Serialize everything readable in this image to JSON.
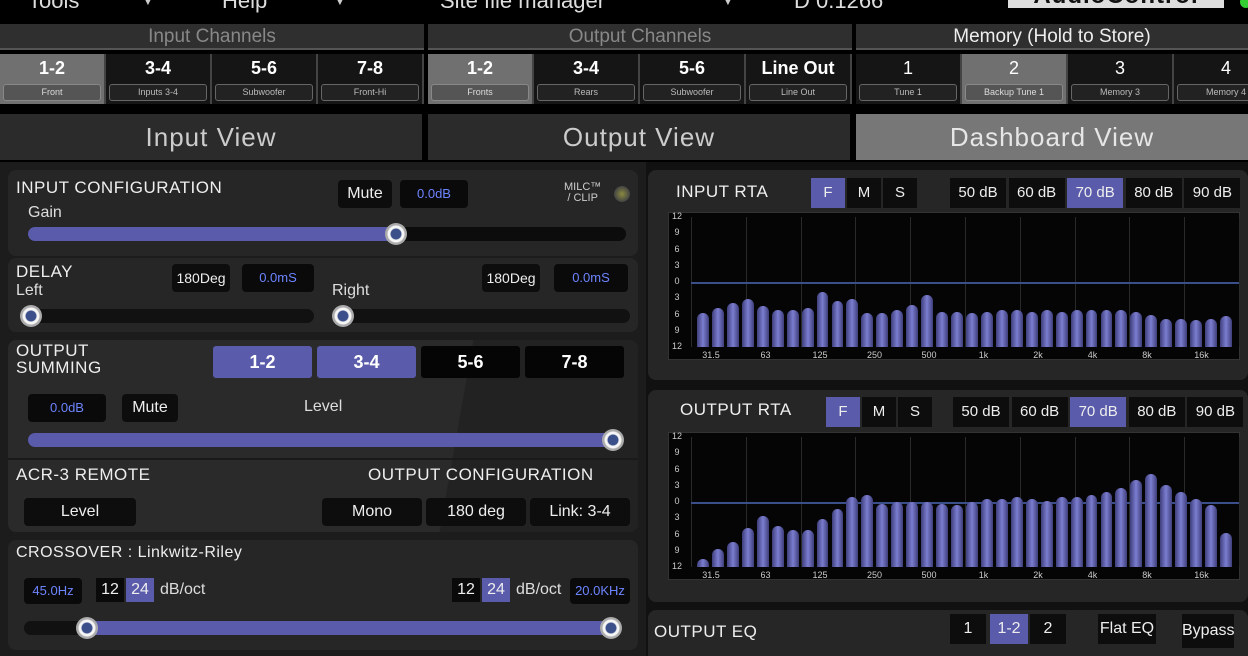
{
  "menu": {
    "tools": "Tools",
    "help": "Help",
    "site_file_manager": "Site file manager",
    "version": "D 0.1266",
    "logo": "AudioControl"
  },
  "input_channels": {
    "title": "Input Channels",
    "items": [
      {
        "num": "1-2",
        "label": "Front"
      },
      {
        "num": "3-4",
        "label": "Inputs 3-4"
      },
      {
        "num": "5-6",
        "label": "Subwoofer"
      },
      {
        "num": "7-8",
        "label": "Front-Hi"
      }
    ],
    "selected": 0
  },
  "output_channels": {
    "title": "Output Channels",
    "items": [
      {
        "num": "1-2",
        "label": "Fronts"
      },
      {
        "num": "3-4",
        "label": "Rears"
      },
      {
        "num": "5-6",
        "label": "Subwoofer"
      },
      {
        "num": "Line Out",
        "label": "Line Out"
      }
    ],
    "selected": 0
  },
  "memory": {
    "title": "Memory (Hold to Store)",
    "items": [
      {
        "num": "1",
        "label": "Tune 1"
      },
      {
        "num": "2",
        "label": "Backup Tune 1"
      },
      {
        "num": "3",
        "label": "Memory 3"
      },
      {
        "num": "4",
        "label": "Memory 4"
      }
    ],
    "selected": 1
  },
  "views": {
    "input": "Input View",
    "output": "Output View",
    "dashboard": "Dashboard View",
    "selected": "dashboard"
  },
  "input_config": {
    "title": "INPUT CONFIGURATION",
    "mute": "Mute",
    "gain_db": "0.0dB",
    "milc_line1": "MILC™",
    "milc_line2": "/ CLIP",
    "gain_label": "Gain",
    "gain_level": 0.62
  },
  "delay": {
    "title": "DELAY",
    "left_label": "Left",
    "right_label": "Right",
    "left_phase": "180Deg",
    "left_time": "0.0mS",
    "right_phase": "180Deg",
    "right_time": "0.0mS",
    "left_level": 0.0,
    "right_level": 0.0
  },
  "output_summing": {
    "title_line1": "OUTPUT",
    "title_line2": "SUMMING",
    "buttons": [
      {
        "label": "1-2",
        "on": true
      },
      {
        "label": "3-4",
        "on": true
      },
      {
        "label": "5-6",
        "on": false
      },
      {
        "label": "7-8",
        "on": false
      }
    ],
    "level_db": "0.0dB",
    "mute": "Mute",
    "level_label": "Level",
    "level": 1.0
  },
  "acr3": {
    "title": "ACR-3 REMOTE",
    "level_btn": "Level"
  },
  "output_config": {
    "title": "OUTPUT CONFIGURATION",
    "mono": "Mono",
    "phase": "180 deg",
    "link": "Link: 3-4"
  },
  "crossover": {
    "title": "CROSSOVER : Linkwitz-Riley",
    "hp_freq": "45.0Hz",
    "lp_freq": "20.0KHz",
    "slope_12": "12",
    "slope_24": "24",
    "unit": "dB/oct",
    "hp_level": 0.09,
    "lp_level": 1.0
  },
  "input_rta": {
    "title": "INPUT RTA",
    "modes": [
      "F",
      "M",
      "S"
    ],
    "mode_sel": 0,
    "ranges": [
      "50 dB",
      "60 dB",
      "70 dB",
      "80 dB",
      "90 dB"
    ],
    "range_sel": 2
  },
  "output_rta": {
    "title": "OUTPUT RTA",
    "modes": [
      "F",
      "M",
      "S"
    ],
    "mode_sel": 0,
    "ranges": [
      "50 dB",
      "60 dB",
      "70 dB",
      "80 dB",
      "90 dB"
    ],
    "range_sel": 2
  },
  "rta_axis": {
    "y_ticks": [
      "12",
      "9",
      "6",
      "3",
      "0",
      "3",
      "6",
      "9",
      "12"
    ],
    "x_ticks": [
      "31.5",
      "63",
      "125",
      "250",
      "500",
      "1k",
      "2k",
      "4k",
      "8k",
      "16k"
    ]
  },
  "input_rta_bars": [
    2.4,
    2.8,
    3.1,
    3.4,
    2.9,
    2.6,
    2.6,
    2.8,
    3.9,
    3.3,
    3.4,
    2.4,
    2.4,
    2.6,
    3.0,
    3.7,
    2.5,
    2.5,
    2.4,
    2.5,
    2.6,
    2.6,
    2.5,
    2.6,
    2.5,
    2.6,
    2.6,
    2.6,
    2.6,
    2.5,
    2.3,
    2.0,
    2.0,
    1.9,
    2.0,
    2.2
  ],
  "output_rta_bars": [
    0.6,
    1.3,
    1.8,
    2.8,
    3.6,
    2.9,
    2.6,
    2.6,
    3.4,
    4.1,
    5.0,
    5.1,
    4.5,
    4.6,
    4.6,
    4.6,
    4.5,
    4.4,
    4.6,
    4.8,
    4.8,
    5.0,
    4.8,
    4.7,
    5.0,
    5.0,
    5.1,
    5.3,
    5.6,
    6.2,
    6.6,
    5.8,
    5.3,
    4.8,
    4.4,
    2.4
  ],
  "output_eq": {
    "title": "OUTPUT EQ",
    "channels": [
      "1",
      "1-2",
      "2"
    ],
    "channel_sel": 1,
    "flat": "Flat EQ",
    "bypass": "Bypass"
  },
  "colors": {
    "accent": "#5a5cab",
    "value_text": "#6d84ff"
  }
}
